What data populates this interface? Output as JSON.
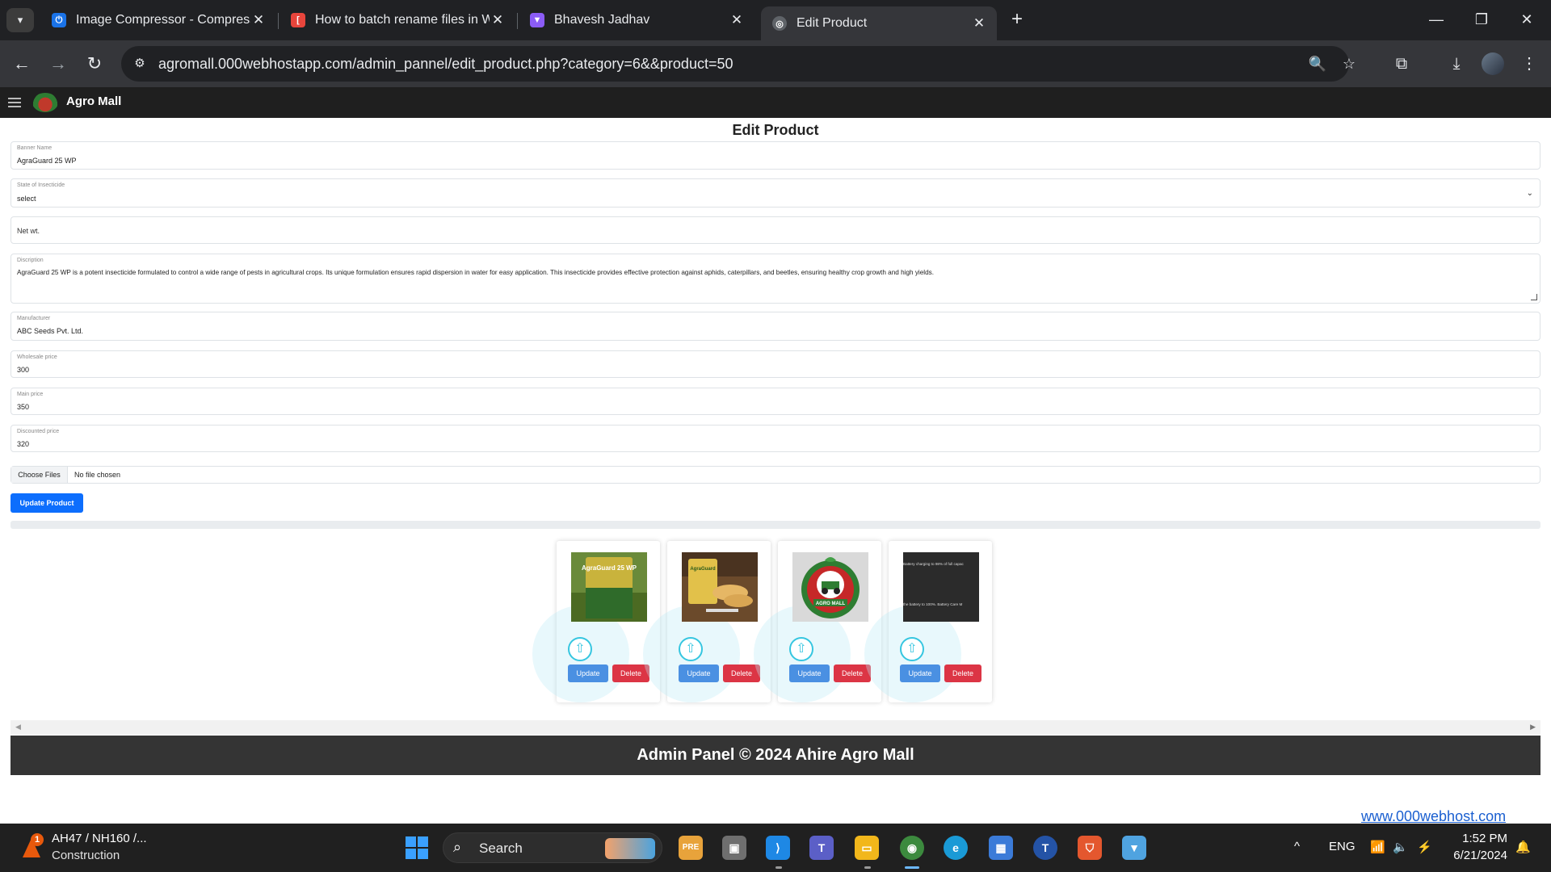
{
  "browser": {
    "tabs": [
      {
        "title": "Image Compressor - Compress",
        "favicon": "image-compressor-favicon",
        "color": "#1a73e8",
        "active": false
      },
      {
        "title": "How to batch rename files in W",
        "favicon": "article-favicon",
        "color": "#e8453c",
        "active": false
      },
      {
        "title": "Bhavesh Jadhav",
        "favicon": "vite-favicon",
        "color": "#8b5cf6",
        "active": false
      },
      {
        "title": "Edit Product",
        "favicon": "globe-icon",
        "color": "#9aa0a6",
        "active": true
      }
    ],
    "url": "agromall.000webhostapp.com/admin_pannel/edit_product.php?category=6&&product=50"
  },
  "app": {
    "brand": "Agro Mall",
    "page_title": "Edit Product"
  },
  "form": {
    "banner_name": {
      "label": "Banner Name",
      "value": "AgraGuard 25 WP"
    },
    "state": {
      "label": "State of Insecticide",
      "value": "select"
    },
    "net_wt": {
      "placeholder": "Net wt."
    },
    "description": {
      "label": "Discription",
      "value": "AgraGuard 25 WP is a potent insecticide formulated to control a wide range of pests in agricultural crops. Its unique formulation ensures rapid dispersion in water for easy application. This insecticide provides effective protection against aphids, caterpillars, and beetles, ensuring healthy crop growth and high yields."
    },
    "manufacturer": {
      "label": "Manufacturer",
      "value": "ABC Seeds Pvt. Ltd."
    },
    "wholesale_price": {
      "label": "Wholesale price",
      "value": "300"
    },
    "main_price": {
      "label": "Main price",
      "value": "350"
    },
    "discounted_price": {
      "label": "Discounted price",
      "value": "320"
    },
    "file": {
      "button": "Choose Files",
      "status": "No file chosen"
    },
    "submit": "Update Product"
  },
  "images": {
    "update_label": "Update",
    "delete_label": "Delete",
    "cards": [
      {
        "name": "agraguard-pack",
        "thumb_text": "AgraGuard 25 WP"
      },
      {
        "name": "seed-packet",
        "thumb_text": "AgraGuard"
      },
      {
        "name": "agro-mall-logo",
        "thumb_text": "AGRO MALL"
      },
      {
        "name": "battery-text",
        "thumb_text_1": "Battery charging to 98% of full capac",
        "thumb_text_2": "the battery to 100%. Battery Care M"
      }
    ]
  },
  "footer": {
    "text": "Admin Panel © 2024 Ahire Agro Mall",
    "host_link": "www.000webhost.com"
  },
  "taskbar": {
    "weather_line1": "AH47 / NH160 /...",
    "weather_line2": "Construction",
    "weather_badge": "1",
    "search": "Search",
    "lang": "ENG",
    "time": "1:52 PM",
    "date": "6/21/2024"
  }
}
